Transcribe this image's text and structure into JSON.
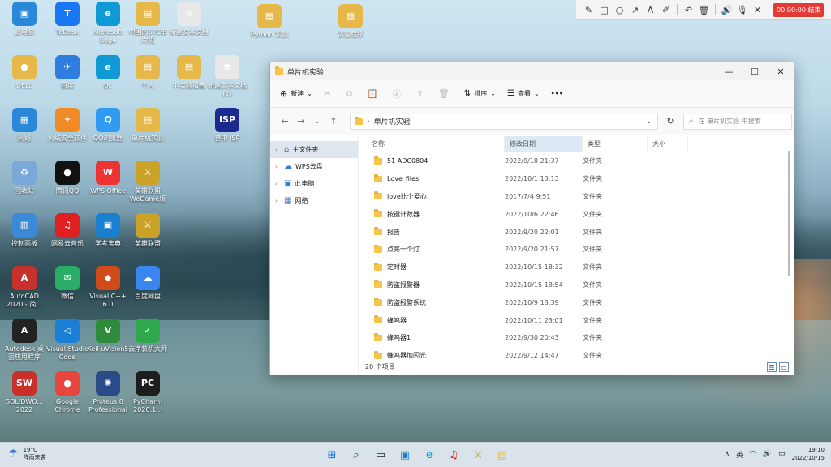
{
  "desktop": {
    "icons": [
      {
        "label": "此电脑",
        "glyph": "▣",
        "color": "#2b88d8"
      },
      {
        "label": "ToDesk",
        "glyph": "T",
        "color": "#1877f2"
      },
      {
        "label": "Microsoft Edge",
        "glyph": "e",
        "color": "#0f9ad6"
      },
      {
        "label": "中国的STC单片机",
        "glyph": "▤",
        "color": "#e6b84a"
      },
      {
        "label": "新建文本文档",
        "glyph": "≡",
        "color": "#e8e8e8"
      },
      {
        "label": "Python 实验",
        "glyph": "▤",
        "color": "#e6b84a"
      },
      {
        "label": "实验程序",
        "glyph": "▤",
        "color": "#e6b84a"
      },
      {
        "label": "DELL",
        "glyph": "●",
        "color": "#e6b84a"
      },
      {
        "label": "百度",
        "glyph": "✈",
        "color": "#2f7de1"
      },
      {
        "label": "pc",
        "glyph": "e",
        "color": "#0f9ad6"
      },
      {
        "label": "个人",
        "glyph": "▤",
        "color": "#e6b84a"
      },
      {
        "label": "4-实验报告",
        "glyph": "▤",
        "color": "#e6b84a"
      },
      {
        "label": "新建文本文档 (2)",
        "glyph": "≡",
        "color": "#e8e8e8"
      },
      {
        "label": "网络",
        "glyph": "▦",
        "color": "#2b88d8"
      },
      {
        "label": "火绒安全软件",
        "glyph": "✦",
        "color": "#f08a24"
      },
      {
        "label": "QQ浏览器",
        "glyph": "Q",
        "color": "#2f9cf2"
      },
      {
        "label": "单片机实验",
        "glyph": "▤",
        "color": "#e6b84a"
      },
      {
        "label": "普中 ISP",
        "glyph": "ISP",
        "color": "#1a2a8f"
      },
      {
        "label": "回收站",
        "glyph": "♻",
        "color": "#7aa8d8"
      },
      {
        "label": "腾讯QQ",
        "glyph": "●",
        "color": "#111"
      },
      {
        "label": "WPS Office",
        "glyph": "W",
        "color": "#e33"
      },
      {
        "label": "英雄联盟 WeGame版",
        "glyph": "⚔",
        "color": "#c9a227"
      },
      {
        "label": "控制面板",
        "glyph": "▥",
        "color": "#3b8ad8"
      },
      {
        "label": "网易云音乐",
        "glyph": "♫",
        "color": "#e02020"
      },
      {
        "label": "学考宝典",
        "glyph": "▣",
        "color": "#1a7fd0"
      },
      {
        "label": "英雄联盟",
        "glyph": "⚔",
        "color": "#c9a227"
      },
      {
        "label": "AutoCAD 2020 - 简...",
        "glyph": "A",
        "color": "#c8302b"
      },
      {
        "label": "微信",
        "glyph": "✉",
        "color": "#2aae67"
      },
      {
        "label": "Visual C++ 6.0",
        "glyph": "◆",
        "color": "#d04a1a"
      },
      {
        "label": "百度网盘",
        "glyph": "☁",
        "color": "#3a86f0"
      },
      {
        "label": "Autodesk 桌面应用程序",
        "glyph": "A",
        "color": "#222"
      },
      {
        "label": "Visual Studio Code",
        "glyph": "◁",
        "color": "#1a7fd6"
      },
      {
        "label": "Keil uVision5",
        "glyph": "V",
        "color": "#2e8b3a"
      },
      {
        "label": "云净装机大师",
        "glyph": "✓",
        "color": "#2ea84a"
      },
      {
        "label": "SOLIDWO... 2022",
        "glyph": "SW",
        "color": "#c8302b"
      },
      {
        "label": "Google Chrome",
        "glyph": "●",
        "color": "#e8453c"
      },
      {
        "label": "Proteus 8 Professional",
        "glyph": "✺",
        "color": "#2a4a8a"
      },
      {
        "label": "PyCharm 2020.1...",
        "glyph": "PC",
        "color": "#1d1d1d"
      }
    ]
  },
  "annotation_toolbar": {
    "tools": [
      "pencil-icon",
      "rectangle-icon",
      "circle-icon",
      "arrow-icon",
      "text-icon",
      "highlighter-icon",
      "undo-icon",
      "trash-icon",
      "speaker-icon",
      "microphone-icon",
      "close-icon"
    ],
    "tool_glyphs": [
      "✎",
      "□",
      "○",
      "↗",
      "A",
      "✐",
      "↶",
      "🗑",
      "🔊",
      "🎙",
      "✕"
    ],
    "record_label": "00:00:00 结束"
  },
  "explorer": {
    "title": "单片机实验",
    "controls": {
      "minimize": "—",
      "maximize": "☐",
      "close": "✕"
    },
    "commands": {
      "new_label": "新建",
      "sort_label": "排序",
      "view_label": "查看",
      "more_label": "•••"
    },
    "path": "单片机实验",
    "search_placeholder": "在 单片机实验 中搜索",
    "sidebar": [
      {
        "label": "主文件夹",
        "icon": "home-icon",
        "glyph": "⌂",
        "selected": true
      },
      {
        "label": "WPS云盘",
        "icon": "cloud-icon",
        "glyph": "☁",
        "selected": false
      },
      {
        "label": "此电脑",
        "icon": "computer-icon",
        "glyph": "▣",
        "selected": false
      },
      {
        "label": "网络",
        "icon": "network-icon",
        "glyph": "▦",
        "selected": false
      }
    ],
    "columns": {
      "name": "名称",
      "date": "修改日期",
      "type": "类型",
      "size": "大小"
    },
    "files": [
      {
        "name": "51 ADC0804",
        "date": "2022/9/18 21:37",
        "type": "文件夹"
      },
      {
        "name": "Love_files",
        "date": "2022/10/1 13:13",
        "type": "文件夹"
      },
      {
        "name": "love比个爱心",
        "date": "2017/7/4 9:51",
        "type": "文件夹"
      },
      {
        "name": "按键计数器",
        "date": "2022/10/6 22:46",
        "type": "文件夹"
      },
      {
        "name": "报告",
        "date": "2022/9/20 22:01",
        "type": "文件夹"
      },
      {
        "name": "点亮一个灯",
        "date": "2022/9/20 21:57",
        "type": "文件夹"
      },
      {
        "name": "定时器",
        "date": "2022/10/15 18:32",
        "type": "文件夹"
      },
      {
        "name": "防盗报警器",
        "date": "2022/10/15 18:54",
        "type": "文件夹"
      },
      {
        "name": "防盗报警系统",
        "date": "2022/10/9 18:39",
        "type": "文件夹"
      },
      {
        "name": "蜂鸣器",
        "date": "2022/10/11 23:01",
        "type": "文件夹"
      },
      {
        "name": "蜂鸣器1",
        "date": "2022/9/30 20:43",
        "type": "文件夹"
      },
      {
        "name": "蜂鸣器加闪光",
        "date": "2022/9/12 14:47",
        "type": "文件夹"
      }
    ],
    "status": "20 个项目"
  },
  "taskbar": {
    "weather_temp": "19°C",
    "weather_desc": "阵雨来袭",
    "apps": [
      {
        "name": "start-icon",
        "glyph": "⊞",
        "color": "#1a73e8"
      },
      {
        "name": "search-icon",
        "glyph": "⌕",
        "color": "#222"
      },
      {
        "name": "taskview-icon",
        "glyph": "▭",
        "color": "#222"
      },
      {
        "name": "store-icon",
        "glyph": "▣",
        "color": "#1a7fd0"
      },
      {
        "name": "edge-icon",
        "glyph": "e",
        "color": "#0f9ad6"
      },
      {
        "name": "netease-music-icon",
        "glyph": "♫",
        "color": "#e02020"
      },
      {
        "name": "league-icon",
        "glyph": "⚔",
        "color": "#c9a227"
      },
      {
        "name": "file-explorer-icon",
        "glyph": "▤",
        "color": "#e6b84a"
      }
    ],
    "tray": {
      "chevron": "∧",
      "ime": "英",
      "wifi": "wifi-icon",
      "volume": "volume-icon",
      "battery": "battery-icon"
    },
    "time": "19:10",
    "date": "2022/10/15"
  }
}
